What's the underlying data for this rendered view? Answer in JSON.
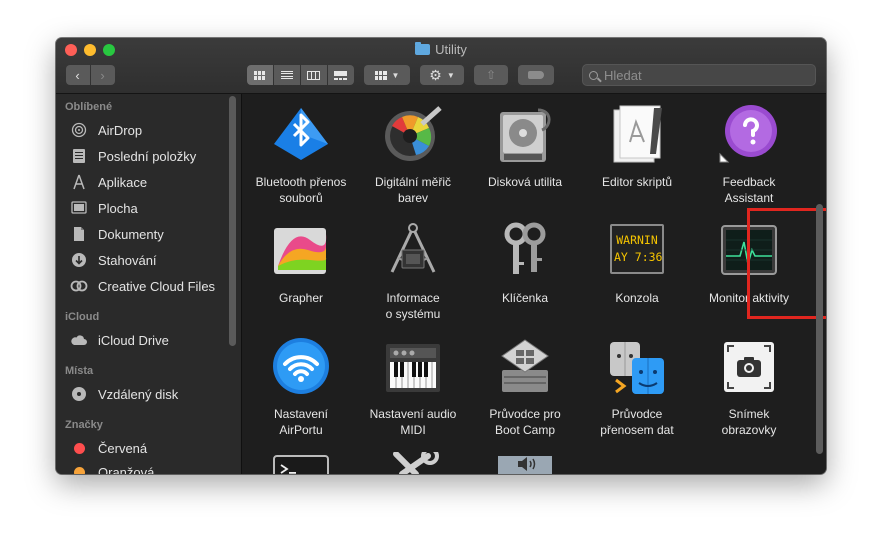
{
  "window": {
    "title": "Utility"
  },
  "toolbar": {
    "search_placeholder": "Hledat",
    "icons": [
      "back-icon",
      "forward-icon",
      "icon-view-icon",
      "list-view-icon",
      "column-view-icon",
      "gallery-view-icon",
      "arrange-icon",
      "gear-icon",
      "share-icon",
      "tag-icon",
      "search-icon"
    ]
  },
  "sidebar": {
    "sections": [
      {
        "title": "Oblíbené",
        "items": [
          {
            "label": "AirDrop",
            "icon": "airdrop-icon"
          },
          {
            "label": "Poslední položky",
            "icon": "recents-icon"
          },
          {
            "label": "Aplikace",
            "icon": "applications-icon"
          },
          {
            "label": "Plocha",
            "icon": "desktop-icon"
          },
          {
            "label": "Dokumenty",
            "icon": "documents-icon"
          },
          {
            "label": "Stahování",
            "icon": "downloads-icon"
          },
          {
            "label": "Creative Cloud Files",
            "icon": "creative-cloud-icon"
          }
        ]
      },
      {
        "title": "iCloud",
        "items": [
          {
            "label": "iCloud Drive",
            "icon": "cloud-icon"
          }
        ]
      },
      {
        "title": "Místa",
        "items": [
          {
            "label": "Vzdálený disk",
            "icon": "disc-icon"
          }
        ]
      },
      {
        "title": "Značky",
        "items": [
          {
            "label": "Červená",
            "icon": "red-tag-icon",
            "color": "#fe4e4e"
          },
          {
            "label": "Oranžová",
            "icon": "orange-tag-icon",
            "color": "#f7a33a"
          }
        ]
      }
    ]
  },
  "apps": [
    {
      "label": "Bluetooth přenos\nsouborů",
      "icon": "bluetooth-icon"
    },
    {
      "label": "Digitální měřič\nbarev",
      "icon": "color-meter-icon"
    },
    {
      "label": "Disková utilita",
      "icon": "disk-utility-icon"
    },
    {
      "label": "Editor skriptů",
      "icon": "script-editor-icon"
    },
    {
      "label": "Feedback\nAssistant",
      "icon": "feedback-icon"
    },
    {
      "label": "Grapher",
      "icon": "grapher-icon"
    },
    {
      "label": "Informace\no systému",
      "icon": "system-info-icon"
    },
    {
      "label": "Klíčenka",
      "icon": "keychain-icon"
    },
    {
      "label": "Konzola",
      "icon": "console-icon",
      "screen_text": [
        "WARNIN",
        "AY 7:36"
      ]
    },
    {
      "label": "Monitor aktivity",
      "icon": "activity-monitor-icon"
    },
    {
      "label": "Nastavení\nAirPortu",
      "icon": "airport-icon"
    },
    {
      "label": "Nastavení audio\nMIDI",
      "icon": "midi-icon"
    },
    {
      "label": "Průvodce pro\nBoot Camp",
      "icon": "bootcamp-icon"
    },
    {
      "label": "Průvodce\npřenosem dat",
      "icon": "migration-icon"
    },
    {
      "label": "Snímek\nobrazovky",
      "icon": "screenshot-icon"
    },
    {
      "label": "",
      "icon": "terminal-icon"
    },
    {
      "label": "",
      "icon": "voiceover-icon"
    },
    {
      "label": "",
      "icon": "audio-icon"
    }
  ],
  "selected_app": "Monitor aktivity"
}
